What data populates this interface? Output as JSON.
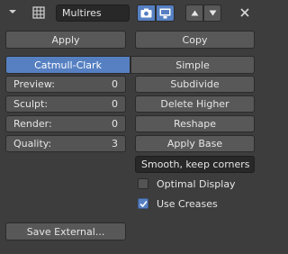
{
  "header": {
    "modifier_name": "Multires",
    "icons": {
      "collapse": "chevron-down-icon",
      "modifier_type": "grid-icon",
      "render": "camera-icon",
      "viewport": "monitor-icon",
      "move_up": "arrow-up-icon",
      "move_down": "arrow-down-icon",
      "delete": "close-icon"
    }
  },
  "actions": {
    "apply": "Apply",
    "copy": "Copy"
  },
  "subdivision_type": {
    "options": [
      "Catmull-Clark",
      "Simple"
    ],
    "selected": "Catmull-Clark"
  },
  "levels": {
    "preview": {
      "label": "Preview:",
      "value": "0"
    },
    "sculpt": {
      "label": "Sculpt:",
      "value": "0"
    },
    "render": {
      "label": "Render:",
      "value": "0"
    },
    "quality": {
      "label": "Quality:",
      "value": "3"
    }
  },
  "ops": {
    "subdivide": "Subdivide",
    "delete_higher": "Delete Higher",
    "reshape": "Reshape",
    "apply_base": "Apply Base"
  },
  "uv_smooth": {
    "value": "Smooth, keep corners"
  },
  "options": {
    "optimal_display": {
      "label": "Optimal Display",
      "checked": false
    },
    "use_creases": {
      "label": "Use Creases",
      "checked": true
    }
  },
  "save_external": "Save External...",
  "colors": {
    "background": "#3d3d3d",
    "button": "#585858",
    "accent": "#5680c2",
    "text": "#e6e6e6"
  }
}
